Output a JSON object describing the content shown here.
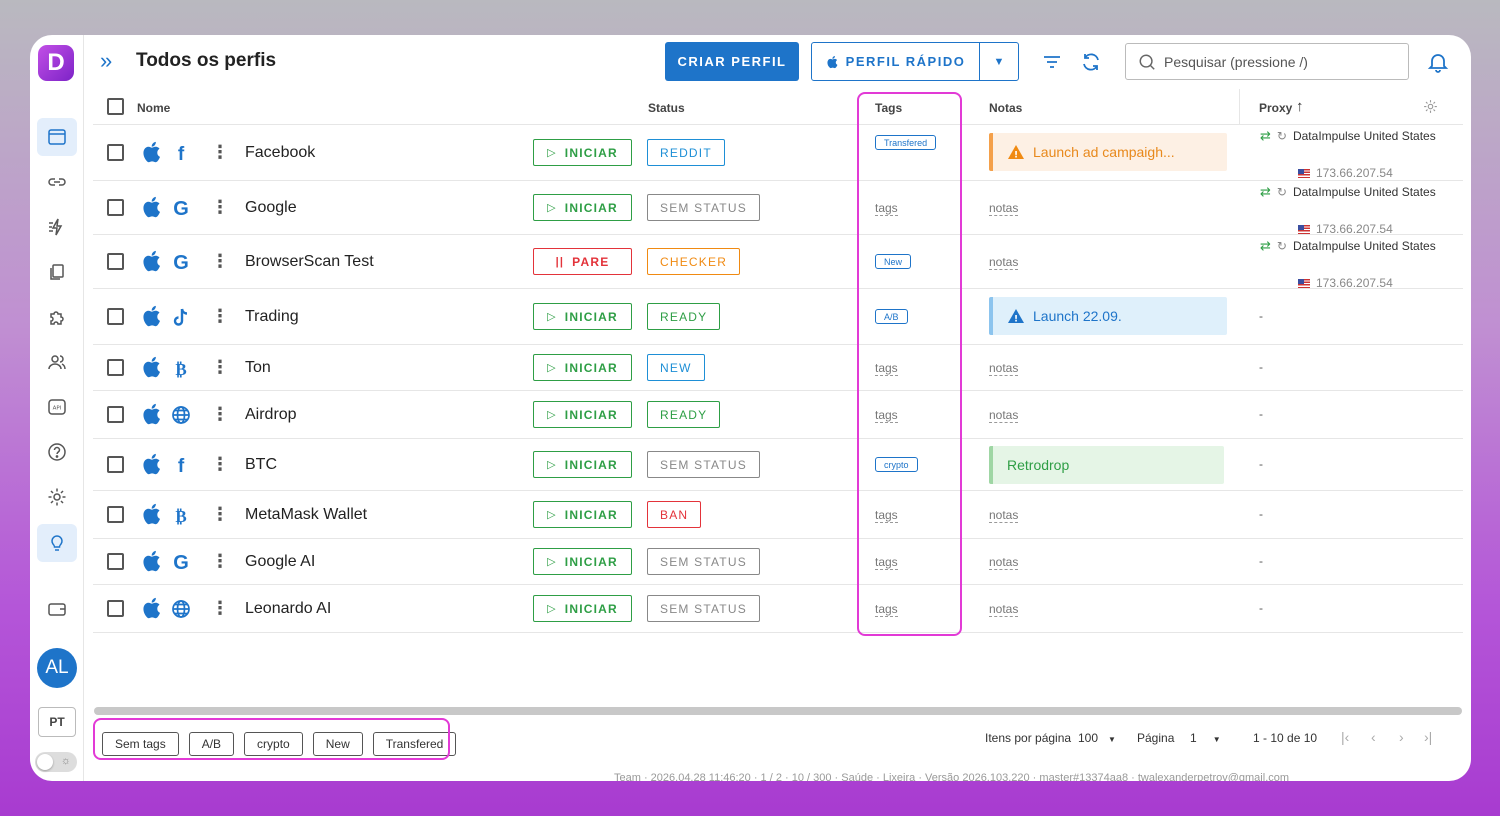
{
  "sidebar": {
    "logo": "D",
    "items": [
      {
        "name": "browser-icon",
        "active": true
      },
      {
        "name": "link-icon"
      },
      {
        "name": "automation-icon"
      },
      {
        "name": "copy-icon"
      },
      {
        "name": "puzzle-icon"
      },
      {
        "name": "users-icon"
      },
      {
        "name": "api-icon"
      },
      {
        "name": "help-icon"
      },
      {
        "name": "gear-icon"
      },
      {
        "name": "lightbulb-icon",
        "active": true
      },
      {
        "name": "wallet-icon"
      }
    ],
    "avatar": "AL",
    "language": "PT"
  },
  "header": {
    "title": "Todos os perfis",
    "create_button": "CRIAR PERFIL",
    "quick_button": "PERFIL RÁPIDO",
    "search_placeholder": "Pesquisar (pressione /)"
  },
  "table": {
    "columns": {
      "name": "Nome",
      "status": "Status",
      "tags": "Tags",
      "notes": "Notas",
      "proxy": "Proxy"
    },
    "tag_placeholder": "tags",
    "note_placeholder": "notas",
    "rows": [
      {
        "name": "Facebook",
        "site": "facebook",
        "action": "INICIAR",
        "status": "REDDIT",
        "status_color": "#1e8fd6",
        "tag": "Transfered",
        "note": "Launch ad campaigh...",
        "note_type": "warning",
        "proxy": {
          "provider": "DataImpulse United States",
          "ip": "173.66.207.54"
        }
      },
      {
        "name": "Google",
        "site": "google",
        "action": "INICIAR",
        "status": "SEM STATUS",
        "status_color": "#888888",
        "tag": "",
        "note": "",
        "proxy": {
          "provider": "DataImpulse United States",
          "ip": "173.66.207.54"
        }
      },
      {
        "name": "BrowserScan Test",
        "site": "google",
        "action": "PARE",
        "status": "CHECKER",
        "status_color": "#f08a12",
        "tag": "New",
        "note": "",
        "proxy": {
          "provider": "DataImpulse United States",
          "ip": "173.66.207.54"
        }
      },
      {
        "name": "Trading",
        "site": "tiktok",
        "action": "INICIAR",
        "status": "READY",
        "status_color": "#2e9e45",
        "tag": "A/B",
        "note": "Launch 22.09.",
        "note_type": "info",
        "proxy": null
      },
      {
        "name": "Ton",
        "site": "bitcoin",
        "action": "INICIAR",
        "status": "NEW",
        "status_color": "#1e8fd6",
        "tag": "",
        "note": "",
        "proxy": null
      },
      {
        "name": "Airdrop",
        "site": "globe",
        "action": "INICIAR",
        "status": "READY",
        "status_color": "#2e9e45",
        "tag": "",
        "note": "",
        "proxy": null
      },
      {
        "name": "BTC",
        "site": "facebook",
        "action": "INICIAR",
        "status": "SEM STATUS",
        "status_color": "#888888",
        "tag": "crypto",
        "note": "Retrodrop",
        "note_type": "success",
        "proxy": null
      },
      {
        "name": "MetaMask Wallet",
        "site": "bitcoin",
        "action": "INICIAR",
        "status": "BAN",
        "status_color": "#e3333a",
        "tag": "",
        "note": "",
        "proxy": null
      },
      {
        "name": "Google AI",
        "site": "google",
        "action": "INICIAR",
        "status": "SEM STATUS",
        "status_color": "#888888",
        "tag": "",
        "note": "",
        "proxy": null
      },
      {
        "name": "Leonardo AI",
        "site": "globe",
        "action": "INICIAR",
        "status": "SEM STATUS",
        "status_color": "#888888",
        "tag": "",
        "note": "",
        "proxy": null
      }
    ],
    "proxy_empty": "-"
  },
  "tag_filters": [
    "Sem tags",
    "A/B",
    "crypto",
    "New",
    "Transfered"
  ],
  "pagination": {
    "items_label": "Itens por página",
    "items_value": "100",
    "page_label": "Página",
    "page_value": "1",
    "range": "1 - 10 de 10"
  },
  "footer": "Team · 2026.04.28 11:46:20 · 1 / 2 · 10 / 300 · Saúde · Lixeira · Versão 2026.103.220 · master#13374aa8 · twalexanderpetrov@gmail.com",
  "colors": {
    "accent": "#1e74c9",
    "start": "#2e9e45",
    "stop": "#e3333a",
    "highlight": "#e23ad6"
  }
}
